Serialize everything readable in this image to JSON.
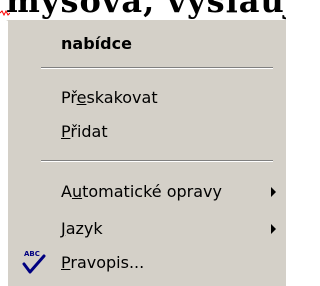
{
  "document": {
    "partial_text": "myšová, výsláujem"
  },
  "context_menu": {
    "items": [
      {
        "label": "nabídce",
        "access_key": "",
        "bold": true,
        "submenu": false
      },
      {
        "label": "Přeskakovat",
        "access_key": "e",
        "bold": false,
        "submenu": false
      },
      {
        "label": "Přidat",
        "access_key": "P",
        "bold": false,
        "submenu": false
      },
      {
        "label": "Automatické opravy",
        "access_key": "u",
        "bold": false,
        "submenu": true
      },
      {
        "label": "Jazyk",
        "access_key": "J",
        "bold": false,
        "submenu": true
      },
      {
        "label": "Pravopis...",
        "access_key": "P",
        "bold": false,
        "submenu": false,
        "icon": "spellcheck-abc-icon",
        "icon_text": "ABC"
      }
    ],
    "colors": {
      "background": "#d4d0c8",
      "separator_dark": "#808080",
      "separator_light": "#ffffff",
      "text": "#000000"
    }
  }
}
